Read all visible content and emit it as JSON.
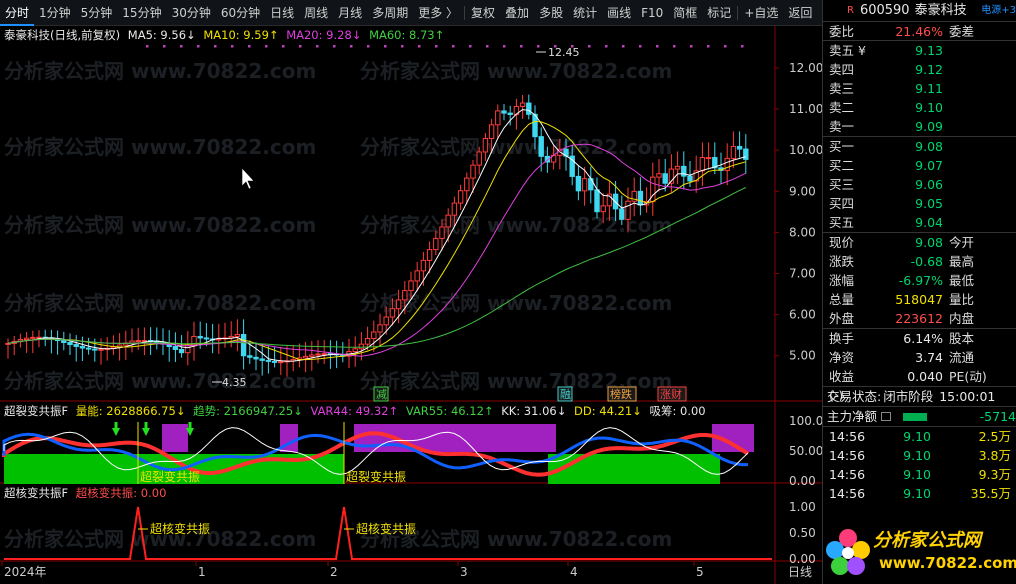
{
  "toolbar": {
    "items": [
      "分时",
      "1分钟",
      "5分钟",
      "15分钟",
      "30分钟",
      "60分钟",
      "日线",
      "周线",
      "月线",
      "多周期",
      "更多 〉",
      "复权",
      "叠加",
      "多股",
      "统计",
      "画线",
      "F10",
      "简框",
      "标记",
      "+自选",
      "返回"
    ]
  },
  "chart": {
    "title": "泰豪科技(日线,前复权)",
    "ma5": "MA5: 9.56↓",
    "ma10": "MA10: 9.59↑",
    "ma20": "MA20: 9.28↓",
    "ma60": "MA60: 8.73↑",
    "y_ticks": [
      "12.00",
      "11.00",
      "10.00",
      "9.00",
      "8.00",
      "7.00",
      "6.00",
      "5.00"
    ],
    "high_label": "12.45",
    "low_label": "4.35",
    "tag_jian": "减",
    "tag_rong": "融",
    "tag_bang": "榜跌",
    "tag_zhang": "涨财"
  },
  "ind1": {
    "name": "超裂变共振F",
    "liangneng": "量能: 2628866.75↓",
    "qushi": "趋势: 2166947.25↓",
    "var44": "VAR44: 49.32↑",
    "var55": "VAR55: 46.12↑",
    "kk": "KK: 31.06↓",
    "dd": "DD: 44.21↓",
    "xichou": "吸筹: 0.00",
    "y_ticks": [
      "100.0",
      "50.00",
      "0.00"
    ],
    "label": "超裂变共振"
  },
  "ind2": {
    "name": "超核变共振F",
    "value": "超核变共振: 0.00",
    "y_ticks": [
      "1.00",
      "0.50",
      "0.00"
    ],
    "label": "超核变共振"
  },
  "xaxis": {
    "labels": [
      "2024年",
      "1",
      "2",
      "3",
      "4",
      "5"
    ],
    "right_label": "日线"
  },
  "watermark": "分析家公式网 www.70822.com",
  "panel": {
    "code": "600590",
    "name": "泰豪科技",
    "source": "电源+3",
    "weibi_label": "委比",
    "weibi_val": "21.46%",
    "weicha_label": "委差",
    "asks": [
      {
        "label": "卖五 ¥",
        "price": "9.13"
      },
      {
        "label": "卖四",
        "price": "9.12"
      },
      {
        "label": "卖三",
        "price": "9.11"
      },
      {
        "label": "卖二",
        "price": "9.10"
      },
      {
        "label": "卖一",
        "price": "9.09"
      }
    ],
    "bids": [
      {
        "label": "买一",
        "price": "9.08"
      },
      {
        "label": "买二",
        "price": "9.07"
      },
      {
        "label": "买三",
        "price": "9.06"
      },
      {
        "label": "买四",
        "price": "9.05"
      },
      {
        "label": "买五",
        "price": "9.04"
      }
    ],
    "stats": [
      {
        "label": "现价",
        "value": "9.08",
        "label2": "今开",
        "color": "green"
      },
      {
        "label": "涨跌",
        "value": "-0.68",
        "label2": "最高",
        "color": "green"
      },
      {
        "label": "涨幅",
        "value": "-6.97%",
        "label2": "最低",
        "color": "green"
      },
      {
        "label": "总量",
        "value": "518047",
        "label2": "量比",
        "color": "yellow"
      },
      {
        "label": "外盘",
        "value": "223612",
        "label2": "内盘",
        "color": "red"
      }
    ],
    "stats2": [
      {
        "label": "换手",
        "value": "6.14%",
        "label2": "股本"
      },
      {
        "label": "净资",
        "value": "3.74",
        "label2": "流通"
      },
      {
        "label": "收益(-)",
        "value": "0.040",
        "label2": "PE(动)"
      }
    ],
    "trade_status_label": "交易状态:",
    "trade_status": "闭市阶段",
    "trade_time": "15:00:01",
    "main_net_label": "主力净额",
    "main_net_value": "-5714",
    "ticks": [
      {
        "time": "14:56",
        "price": "9.10",
        "vol": "2.5万"
      },
      {
        "time": "14:56",
        "price": "9.10",
        "vol": "3.8万"
      },
      {
        "time": "14:56",
        "price": "9.10",
        "vol": "9.3万"
      },
      {
        "time": "14:56",
        "price": "9.10",
        "vol": "35.5万"
      }
    ],
    "logo_text": "分析家公式网",
    "logo_url": "www.70822.com"
  }
}
